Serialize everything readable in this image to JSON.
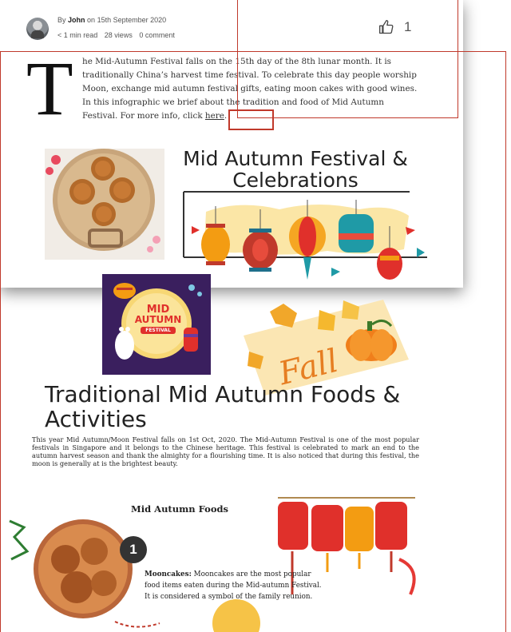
{
  "meta": {
    "by_prefix": "By",
    "author": "John",
    "date_prefix": "on",
    "date": "15th September 2020",
    "read_time": "< 1 min read",
    "views": "28 views",
    "comments": "0 comment",
    "like_count": "1"
  },
  "article": {
    "dropcap": "T",
    "intro_text": "he Mid-Autumn Festival falls on the 15th day of the 8th lunar month. It is traditionally China’s harvest time festival. To celebrate this day people worship Moon, exchange mid autumn festival gifts, eating moon cakes with good wines. In this infographic we brief about the tradition and food of Mid Autumn Festival. For more info, click ",
    "link_text": "here",
    "link_suffix": "."
  },
  "infographic": {
    "title": "Mid Autumn Festival & Celebrations",
    "badge_line1": "MID",
    "badge_line2": "AUTUMN",
    "badge_line3": "FESTIVAL",
    "fall_label": "Fall",
    "heading2": "Traditional Mid Autumn Foods & Activities",
    "paragraph": "This year Mid Autumn/Moon Festival falls on 1st Oct, 2020. The Mid-Autumn Festival is one of the most popular festivals in Singapore and it belongs to the Chinese heritage. This festival is celebrated to mark an end to the autumn harvest season and thank the almighty for a flourishing time. It is also noticed that during this festival, the moon is generally at is the brightest beauty.",
    "foods_title": "Mid Autumn Foods",
    "step_number": "1",
    "mooncakes_label": "Mooncakes:",
    "mooncakes_text": " Mooncakes are the most popular food items eaten during the Mid-autumn Festival. It is considered a symbol of the family reunion."
  },
  "colors": {
    "highlight": "#c0392b",
    "lantern_red": "#e0302b",
    "lantern_orange": "#f39c12",
    "lantern_teal": "#1f9aa6",
    "badge_purple": "#3a1f5e"
  }
}
